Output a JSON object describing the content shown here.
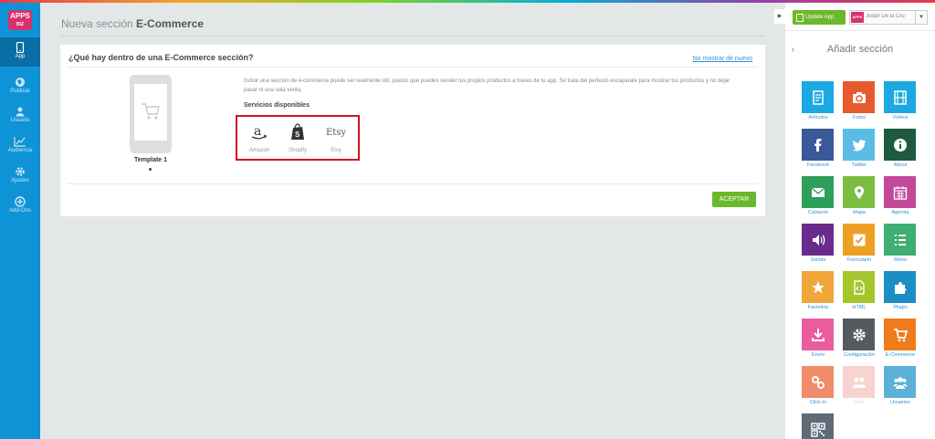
{
  "nav": {
    "logo_text": "APPS",
    "logo_sub": "BIZ",
    "items": [
      {
        "label": "App",
        "icon": "phone-icon"
      },
      {
        "label": "Publicar",
        "icon": "globe-icon"
      },
      {
        "label": "Usuario",
        "icon": "user-icon"
      },
      {
        "label": "Audiencia",
        "icon": "chart-icon"
      },
      {
        "label": "Ajustes",
        "icon": "gear-icon"
      },
      {
        "label": "Add-Ons",
        "icon": "plus-icon"
      }
    ]
  },
  "main": {
    "title_prefix": "Nueva sección ",
    "title_bold": "E-Commerce",
    "card": {
      "heading": "¿Qué hay dentro de una E-Commerce sección?",
      "hide_link": "No mostrar de nuevo",
      "template_label": "Template 1",
      "description": "Incluir una sección de e-commerce puede ser realmente útil, puesto que puedes vender tus propios productos a traves de tu app. Se trata del perfecto escaparate para mostrar tus productos y no dejar pasar ni una sola venta.",
      "services_title": "Servicios disponibles",
      "services": [
        {
          "name": "Amazon",
          "icon": "amazon-icon"
        },
        {
          "name": "Shopify",
          "icon": "shopify-icon"
        },
        {
          "name": "Etsy",
          "icon": "etsy-icon",
          "logo_text": "Etsy"
        }
      ],
      "accept_label": "ACEPTAR"
    }
  },
  "right": {
    "update_label": "Update App",
    "user_name": "Julián De la Cru",
    "avatar_text": "APPS",
    "title": "Añadir sección",
    "tiles": [
      {
        "label": "Artículos",
        "color": "#1aa9e0",
        "icon": "article-icon"
      },
      {
        "label": "Fotos",
        "color": "#e55b2d",
        "icon": "camera-icon"
      },
      {
        "label": "Vídeos",
        "color": "#1aa9e0",
        "icon": "film-icon"
      },
      {
        "label": "Facebook",
        "color": "#3b5998",
        "icon": "facebook-icon"
      },
      {
        "label": "Twitter",
        "color": "#5bbce4",
        "icon": "twitter-icon"
      },
      {
        "label": "About",
        "color": "#1d5a3e",
        "icon": "info-icon"
      },
      {
        "label": "Contacto",
        "color": "#2e9e5b",
        "icon": "envelope-icon"
      },
      {
        "label": "Mapa",
        "color": "#7bbd42",
        "icon": "map-pin-icon"
      },
      {
        "label": "Agenda",
        "color": "#c2489a",
        "icon": "calendar-icon"
      },
      {
        "label": "Sonido",
        "color": "#6a2c8c",
        "icon": "speaker-icon"
      },
      {
        "label": "Formulario",
        "color": "#eea025",
        "icon": "checkbox-icon"
      },
      {
        "label": "Menú",
        "color": "#3fae72",
        "icon": "list-icon"
      },
      {
        "label": "Favoritos",
        "color": "#f0a63a",
        "icon": "star-icon"
      },
      {
        "label": "HTML",
        "color": "#a4c62b",
        "icon": "html-icon"
      },
      {
        "label": "Plugin",
        "color": "#1b8fc4",
        "icon": "puzzle-icon"
      },
      {
        "label": "Envío",
        "color": "#ea5ba0",
        "icon": "download-icon"
      },
      {
        "label": "Configuración",
        "color": "#555a5e",
        "icon": "gear-icon"
      },
      {
        "label": "E-Commerce",
        "color": "#f07b1c",
        "icon": "cart-icon"
      },
      {
        "label": "Click to",
        "color": "#f08c6a",
        "icon": "link-icon"
      },
      {
        "label": "Chat",
        "color": "#f7d4d0",
        "icon": "chat-icon"
      },
      {
        "label": "Usuarios",
        "color": "#5bb1d8",
        "icon": "users-icon"
      },
      {
        "label": "",
        "color": "#5e6c78",
        "icon": "qr-icon"
      }
    ]
  }
}
